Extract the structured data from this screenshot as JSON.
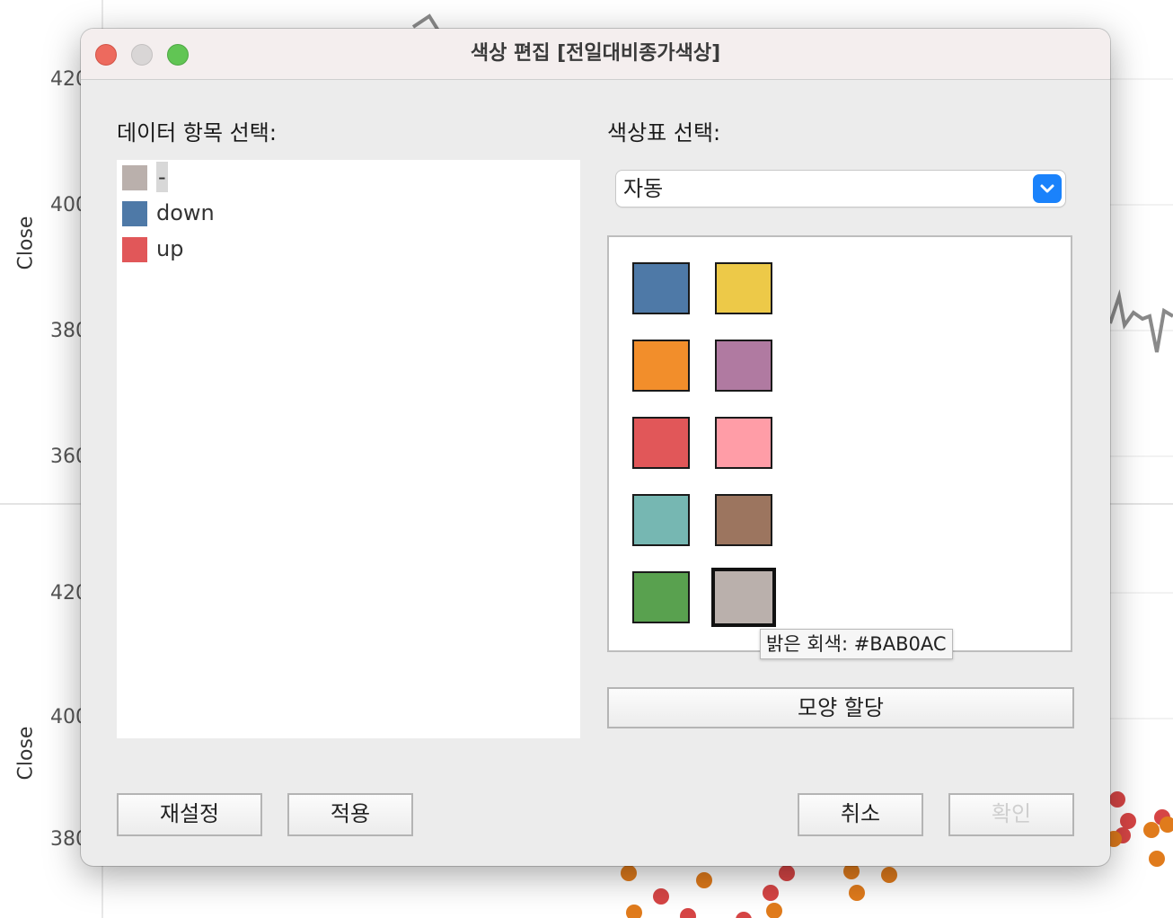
{
  "background_chart": {
    "ylabel": "Close",
    "top_ticks": [
      "420",
      "400",
      "380",
      "360"
    ],
    "bottom_ticks": [
      "420",
      "400",
      "380"
    ]
  },
  "dialog": {
    "title": "색상 편집 [전일대비종가색상]",
    "data_items_label": "데이터 항목 선택:",
    "palette_label": "색상표 선택:",
    "items": [
      {
        "label": "-",
        "color": "#BAB0AC",
        "selected": true
      },
      {
        "label": "down",
        "color": "#4E79A7",
        "selected": false
      },
      {
        "label": "up",
        "color": "#E15759",
        "selected": false
      }
    ],
    "palette_select": {
      "value": "자동",
      "icon": "chevron-down-icon"
    },
    "palette_colors": [
      [
        "#4E79A7",
        "#EDC948"
      ],
      [
        "#F28E2B",
        "#B07AA1"
      ],
      [
        "#E15759",
        "#FF9DA7"
      ],
      [
        "#76B7B2",
        "#9C755F"
      ],
      [
        "#59A14F",
        "#BAB0AC"
      ]
    ],
    "selected_color_index": [
      4,
      1
    ],
    "tooltip": "밝은 회색: #BAB0AC",
    "assign_shape_button": "모양 할당",
    "reset_button": "재설정",
    "apply_button": "적용",
    "cancel_button": "취소",
    "ok_button": "확인"
  }
}
